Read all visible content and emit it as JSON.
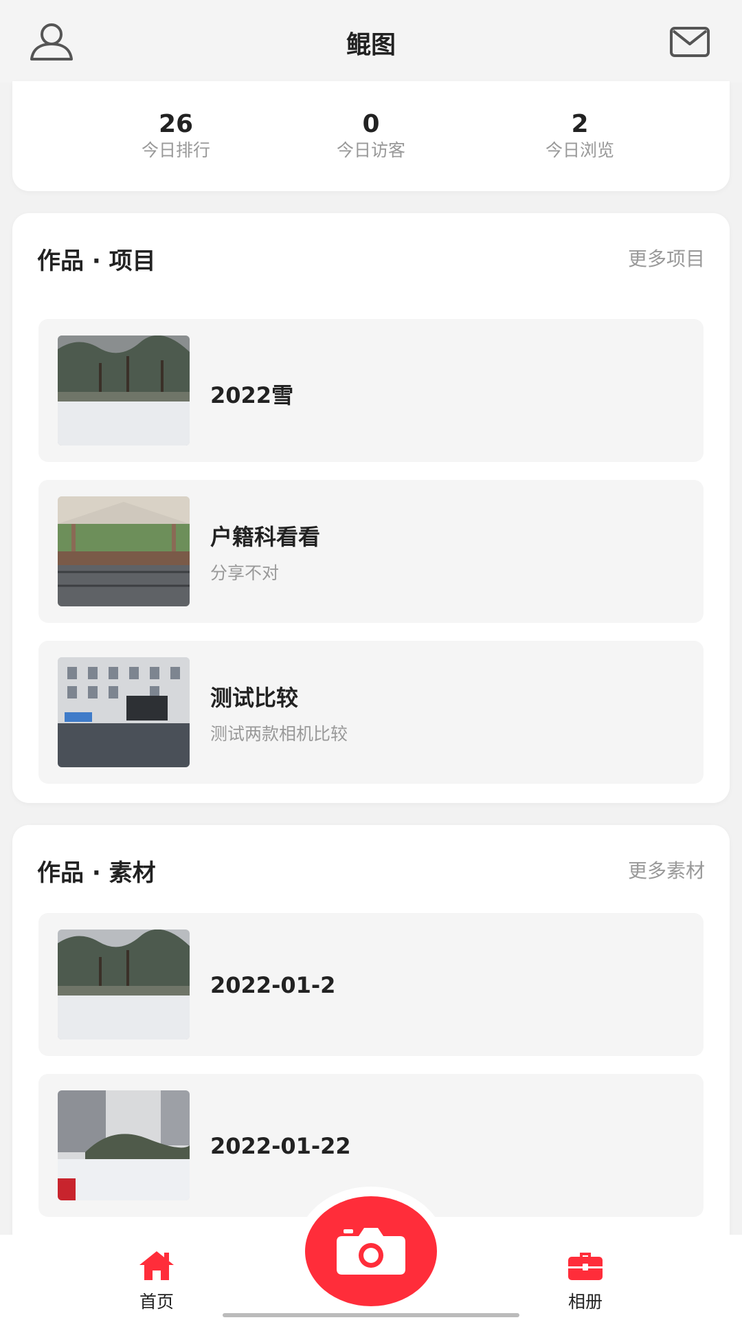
{
  "header": {
    "title": "鲲图"
  },
  "stats": [
    {
      "value": "26",
      "label": "今日排行"
    },
    {
      "value": "0",
      "label": "今日访客"
    },
    {
      "value": "2",
      "label": "今日浏览"
    }
  ],
  "projects": {
    "title": "作品 · 项目",
    "more": "更多项目",
    "items": [
      {
        "name": "2022雪",
        "desc": ""
      },
      {
        "name": "户籍科看看",
        "desc": "分享不对"
      },
      {
        "name": "测试比较",
        "desc": "测试两款相机比较"
      }
    ]
  },
  "materials": {
    "title": "作品 · 素材",
    "more": "更多素材",
    "items": [
      {
        "name": "2022-01-2"
      },
      {
        "name": "2022-01-22"
      }
    ]
  },
  "nav": {
    "home": "首页",
    "album": "相册"
  },
  "colors": {
    "accent": "#ff2d3a",
    "background": "#f2f2f2"
  },
  "icons": {
    "user": "user-outline-icon",
    "mail": "mail-icon",
    "home": "home-icon",
    "camera": "camera-icon",
    "album": "briefcase-icon"
  }
}
